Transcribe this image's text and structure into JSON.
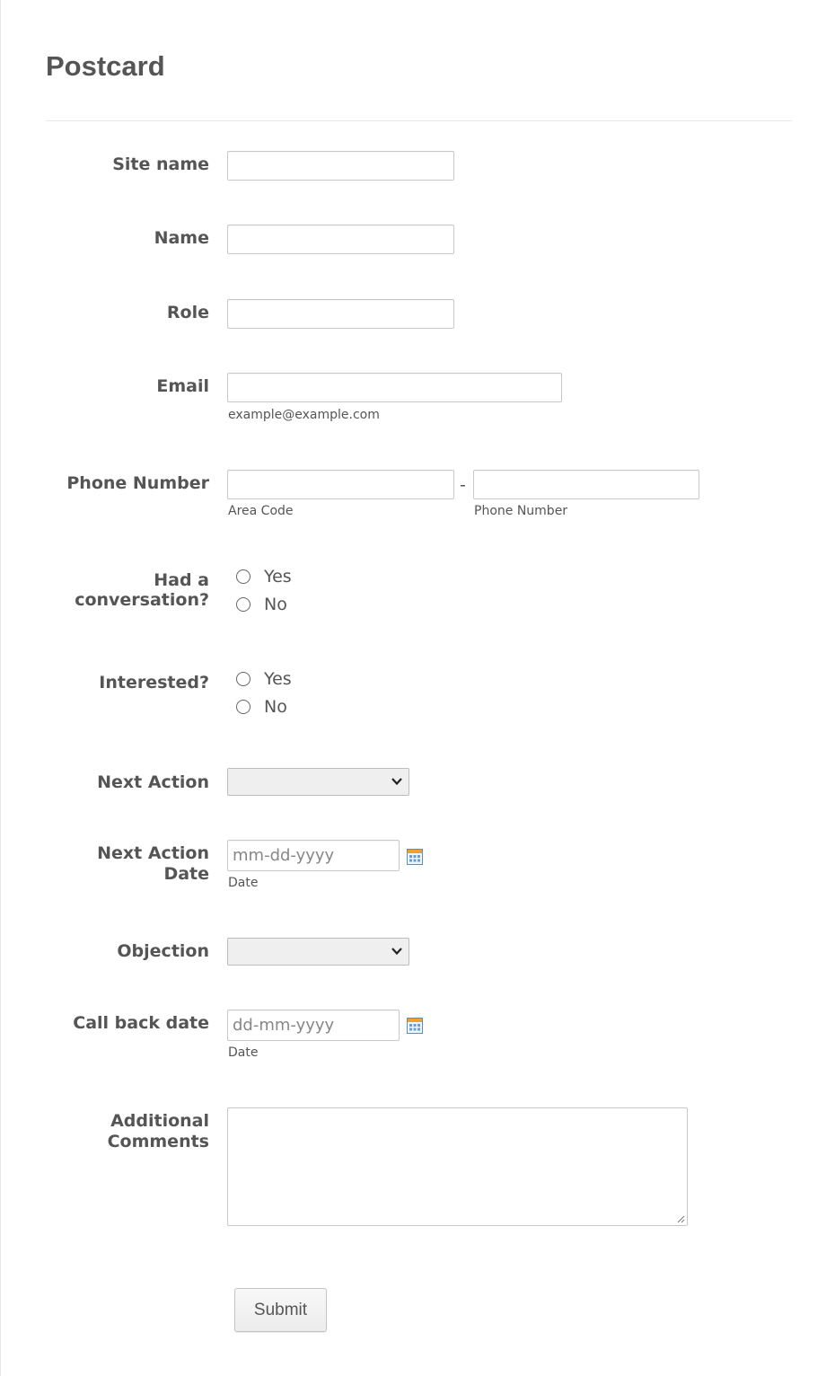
{
  "form": {
    "title": "Postcard",
    "submit_label": "Submit"
  },
  "fields": {
    "site_name": {
      "label": "Site name",
      "value": ""
    },
    "name": {
      "label": "Name",
      "value": ""
    },
    "role": {
      "label": "Role",
      "value": ""
    },
    "email": {
      "label": "Email",
      "value": "",
      "sublabel": "example@example.com"
    },
    "phone": {
      "label": "Phone Number",
      "separator": "-",
      "area_code_sublabel": "Area Code",
      "number_sublabel": "Phone Number"
    },
    "had_conversation": {
      "label_line1": "Had a",
      "label_line2": "conversation?",
      "options": [
        "Yes",
        "No"
      ],
      "selected": null
    },
    "interested": {
      "label": "Interested?",
      "options": [
        "Yes",
        "No"
      ],
      "selected": null
    },
    "next_action": {
      "label": "Next Action",
      "selected": ""
    },
    "next_action_date": {
      "label_line1": "Next Action",
      "label_line2": "Date",
      "placeholder": "mm-dd-yyyy",
      "sublabel": "Date"
    },
    "objection": {
      "label": "Objection",
      "selected": ""
    },
    "call_back_date": {
      "label": "Call back date",
      "placeholder": "dd-mm-yyyy",
      "sublabel": "Date"
    },
    "additional_comments": {
      "label_line1": "Additional",
      "label_line2": "Comments",
      "value": ""
    }
  },
  "icons": {
    "calendar": "calendar-icon",
    "dropdown": "chevron-down-icon",
    "resize": "resize-grip-icon"
  },
  "colors": {
    "text": "#555555",
    "border": "#c8c8c8",
    "select_bg": "#efefef",
    "calendar_accent": "#f0a030",
    "calendar_blue": "#4a90c8"
  }
}
